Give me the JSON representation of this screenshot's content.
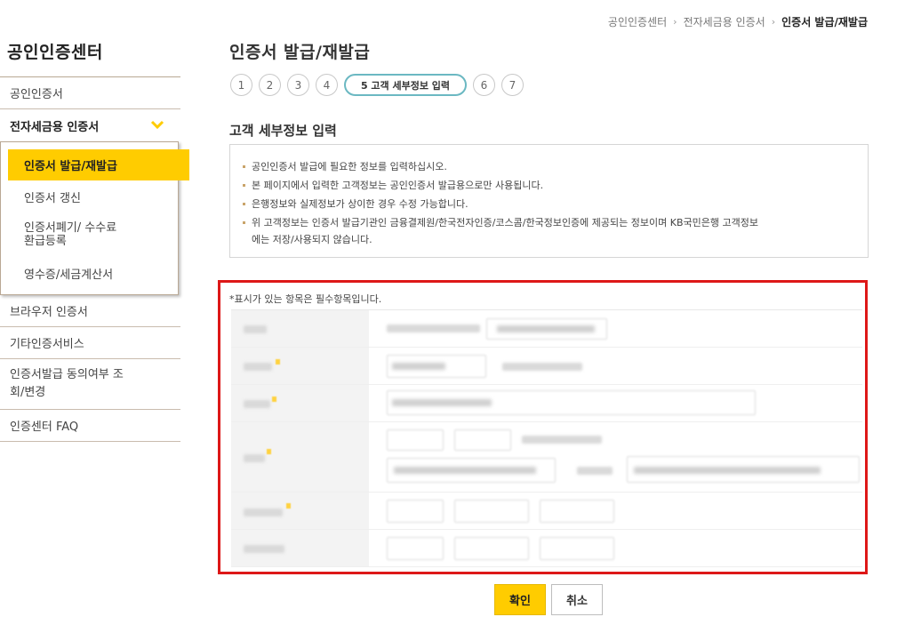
{
  "breadcrumb": {
    "items": [
      "공인인증센터",
      "전자세금용 인증서"
    ],
    "current": "인증서 발급/재발급"
  },
  "sidebar": {
    "title": "공인인증센터",
    "items": [
      {
        "label": "공인인증서"
      },
      {
        "label": "전자세금용 인증서"
      },
      {
        "label": "브라우저 인증서"
      },
      {
        "label": "기타인증서비스"
      },
      {
        "label": "인증서발급 동의여부 조회/변경"
      },
      {
        "label": "인증센터 FAQ"
      }
    ],
    "submenu": [
      {
        "label": "인증서 발급/재발급"
      },
      {
        "label": "인증서 갱신"
      },
      {
        "label": "인증서폐기/ 수수료 환급등록"
      },
      {
        "label": "영수증/세금계산서"
      }
    ]
  },
  "main": {
    "title": "인증서 발급/재발급",
    "steps": [
      "1",
      "2",
      "3",
      "4",
      "5 고객 세부정보 입력",
      "6",
      "7"
    ],
    "section_title": "고객 세부정보 입력",
    "notices": [
      "공인인증서 발급에 필요한 정보를 입력하십시오.",
      "본 페이지에서 입력한 고객정보는 공인인증서 발급용으로만 사용됩니다.",
      "은행정보와 실제정보가 상이한 경우 수정 가능합니다.",
      "위 고객정보는 인증서 발급기관인 금융결제원/한국전자인증/코스콤/한국정보인증에 제공되는 정보이며 KB국민은행 고객정보",
      "에는 저장/사용되지 않습니다."
    ],
    "required_note": "*표시가 있는 항목은 필수항목입니다."
  },
  "buttons": {
    "confirm": "확인",
    "cancel": "취소"
  },
  "colors": {
    "accent": "#ffcc00",
    "highlight_border": "#dd1818",
    "step_active_border": "#6bb8c2"
  }
}
